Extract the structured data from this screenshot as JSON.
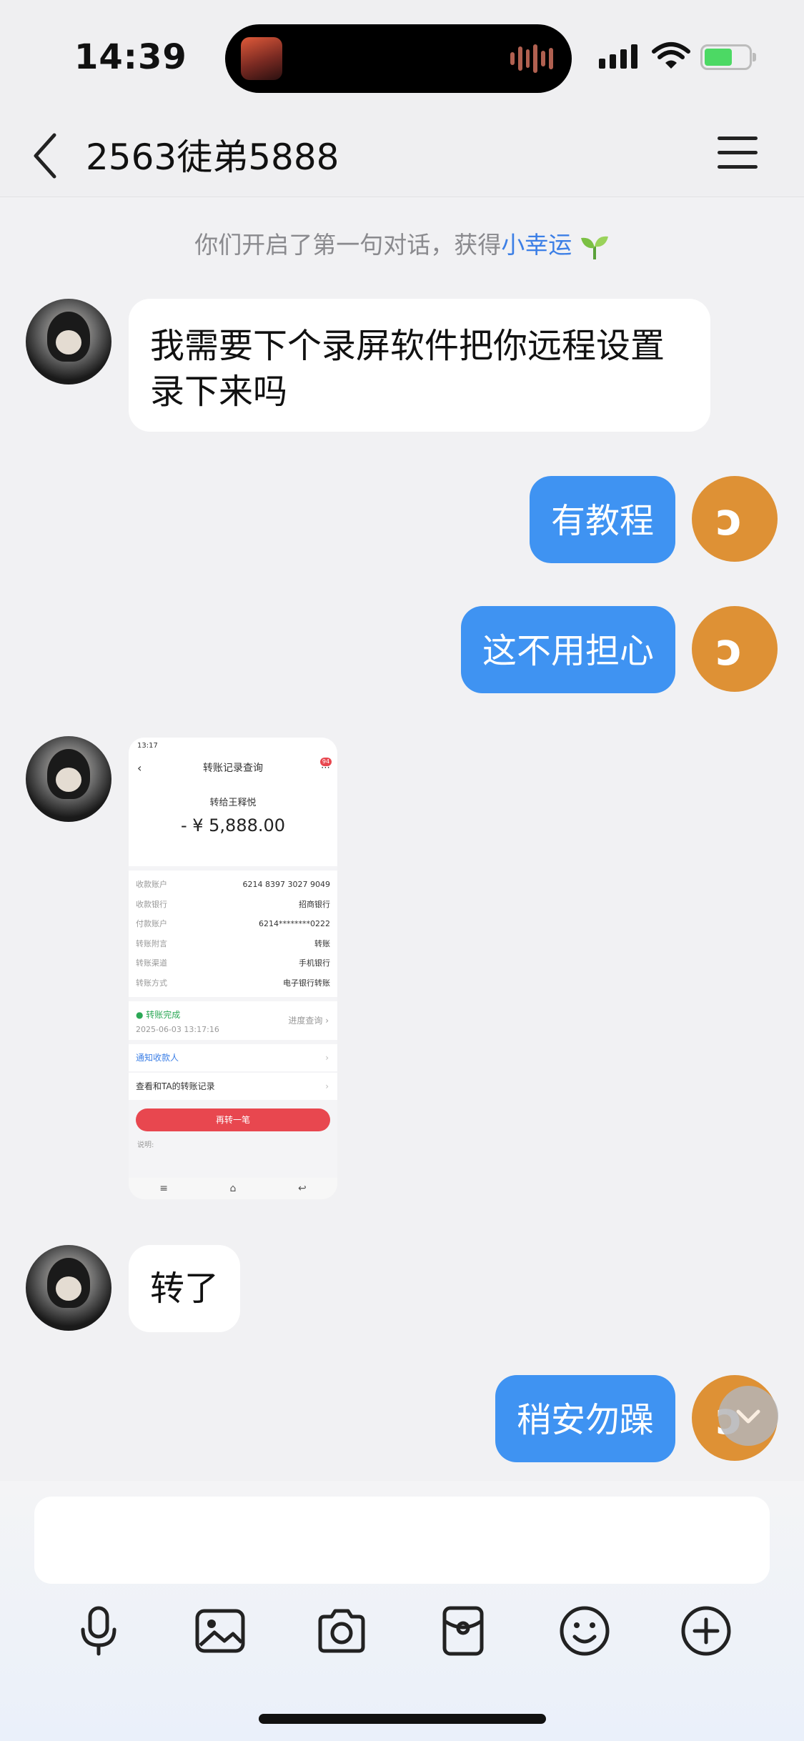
{
  "status_bar": {
    "time": "14:39",
    "icons": [
      "signal-icon",
      "wifi-icon",
      "battery-charging-icon"
    ]
  },
  "header": {
    "title": "2563徒弟5888",
    "back_icon": "chevron-left-icon",
    "menu_icon": "hamburger-menu-icon"
  },
  "system_message": {
    "text": "你们开启了第一句对话，获得",
    "highlight": "小幸运",
    "icon": "sprout-icon",
    "highlight_color": "#3c7fe6"
  },
  "messages": [
    {
      "side": "left",
      "type": "text",
      "text": "我需要下个录屏软件把你远程设置录下来吗"
    },
    {
      "side": "right",
      "type": "text",
      "text": "有教程"
    },
    {
      "side": "right",
      "type": "text",
      "text": "这不用担心"
    },
    {
      "side": "left",
      "type": "image",
      "description": "转账记录截图"
    },
    {
      "side": "left",
      "type": "text",
      "text": "转了"
    },
    {
      "side": "right",
      "type": "text",
      "text": "稍安勿躁"
    }
  ],
  "receipt": {
    "status_time": "13:17",
    "title": "转账记录查询",
    "badge": "94",
    "recipient": "转给王释悦",
    "amount": "- ¥ 5,888.00",
    "rows": [
      {
        "label": "收款账户",
        "value": "6214 8397 3027 9049"
      },
      {
        "label": "收款银行",
        "value": "招商银行"
      },
      {
        "label": "付款账户",
        "value": "6214********0222"
      },
      {
        "label": "转账附言",
        "value": "转账"
      },
      {
        "label": "转账渠道",
        "value": "手机银行"
      },
      {
        "label": "转账方式",
        "value": "电子银行转账"
      }
    ],
    "progress_status": "● 转账完成",
    "progress_time": "2025-06-03 13:17:16",
    "progress_link": "进度查询 ›",
    "notify_link": "通知收款人",
    "history_link": "查看和TA的转账记录",
    "again_button": "再转一笔",
    "note": "说明:"
  },
  "composer": {
    "input_value": "",
    "tools": [
      "microphone-icon",
      "image-icon",
      "camera-icon",
      "red-packet-icon",
      "emoji-icon",
      "plus-icon"
    ]
  },
  "colors": {
    "accent": "#3f93f2",
    "avatar_right": "#de9135",
    "receipt_button": "#e8474f"
  }
}
